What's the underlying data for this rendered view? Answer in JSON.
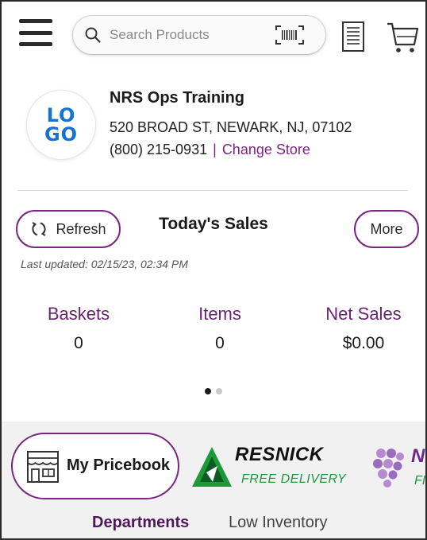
{
  "header": {
    "menu_icon": "hamburger-menu-icon",
    "search": {
      "placeholder": "Search Products",
      "value": ""
    },
    "scan_icon": "barcode-scan-icon",
    "list_icon": "receipt-list-icon",
    "cart_icon": "shopping-cart-icon"
  },
  "store": {
    "logo_line1": "LO",
    "logo_line2": "GO",
    "name": "NRS Ops Training",
    "address": "520 BROAD ST,  NEWARK,  NJ, 07102",
    "phone": "(800) 215-0931",
    "separator": "|",
    "change_store_label": "Change Store"
  },
  "sales": {
    "refresh_label": "Refresh",
    "title": "Today's Sales",
    "more_label": "More",
    "last_updated": "Last updated:  02/15/23, 02:34 PM",
    "stats": [
      {
        "label": "Baskets",
        "value": "0"
      },
      {
        "label": "Items",
        "value": "0"
      },
      {
        "label": "Net Sales",
        "value": "$0.00"
      }
    ],
    "pager": {
      "pages": 2,
      "current": 1
    }
  },
  "shortcuts": {
    "pricebook_label": "My Pricebook",
    "partners": [
      {
        "name": "RESNICK",
        "sub": "FREE DELIVERY"
      },
      {
        "name": "NI",
        "sub": "FI"
      }
    ]
  },
  "tabs": [
    {
      "label": "Departments",
      "active": true
    },
    {
      "label": "Low Inventory",
      "active": false
    }
  ],
  "colors": {
    "accent": "#7a2583",
    "label_purple": "#6a2273",
    "logo_blue": "#1673d1",
    "delivery_green": "#1c9a3a"
  }
}
